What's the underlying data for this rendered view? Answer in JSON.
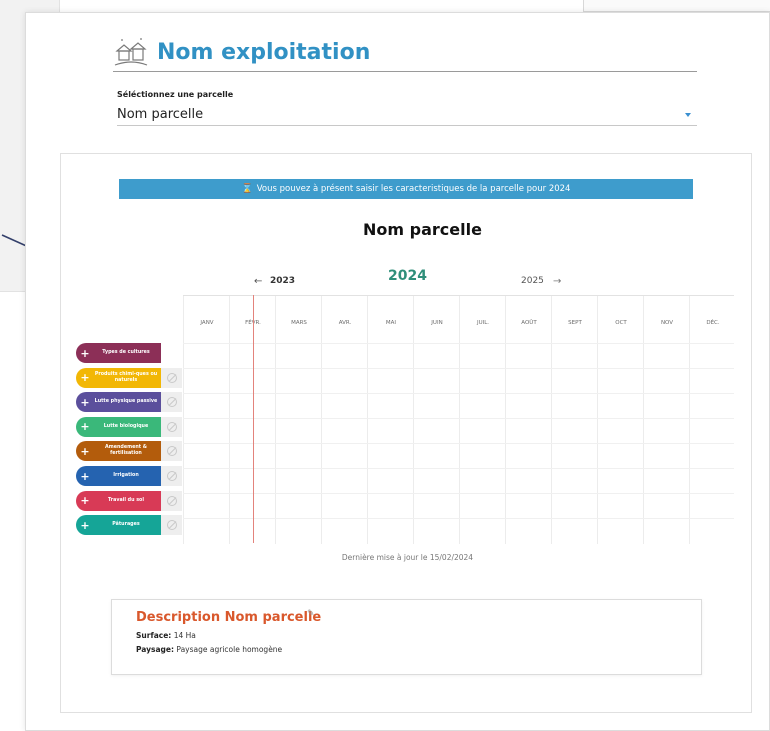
{
  "header": {
    "title": "Nom exploitation"
  },
  "parcel_select": {
    "label": "Séléctionnez une parcelle",
    "value": "Nom parcelle"
  },
  "banner": {
    "text": "Vous pouvez à présent saisir les caracteristiques de la parcelle pour 2024",
    "color": "#3e9ccc"
  },
  "parcel_title": "Nom parcelle",
  "years": {
    "prev": "2023",
    "current": "2024",
    "next": "2025",
    "prev_arrow": "←",
    "next_arrow": "→"
  },
  "months": [
    "JANV",
    "FÉVR.",
    "MARS",
    "AVR.",
    "MAI",
    "JUIN",
    "JUIL.",
    "AOÛT",
    "SEPT",
    "OCT",
    "NOV",
    "DÉC."
  ],
  "categories": [
    {
      "label": "Types de cultures",
      "color": "#8c2f57",
      "eye": false
    },
    {
      "label": "Produits chimi-ques ou naturels",
      "color": "#f2b705",
      "eye": true
    },
    {
      "label": "Lutte physique passive",
      "color": "#5b4f9c",
      "eye": true
    },
    {
      "label": "Lutte biologique",
      "color": "#3ab87a",
      "eye": true
    },
    {
      "label": "Amendement & fertilisation",
      "color": "#b35c0c",
      "eye": true
    },
    {
      "label": "Irrigation",
      "color": "#2563b0",
      "eye": true
    },
    {
      "label": "Travail du sol",
      "color": "#d83a56",
      "eye": true
    },
    {
      "label": "Pâturages",
      "color": "#15a597",
      "eye": true
    }
  ],
  "update_note": "Dernière mise à jour le 15/02/2024",
  "description": {
    "title": "Description Nom parcelle",
    "surface_label": "Surface",
    "surface_value": "14 Ha",
    "landscape_label": "Paysage",
    "landscape_value": "Paysage agricole homogène"
  },
  "icons": {
    "farm": "farm-icon",
    "hourglass": "hourglass-icon",
    "edit": "edit-icon",
    "hide": "eye-off-icon"
  }
}
